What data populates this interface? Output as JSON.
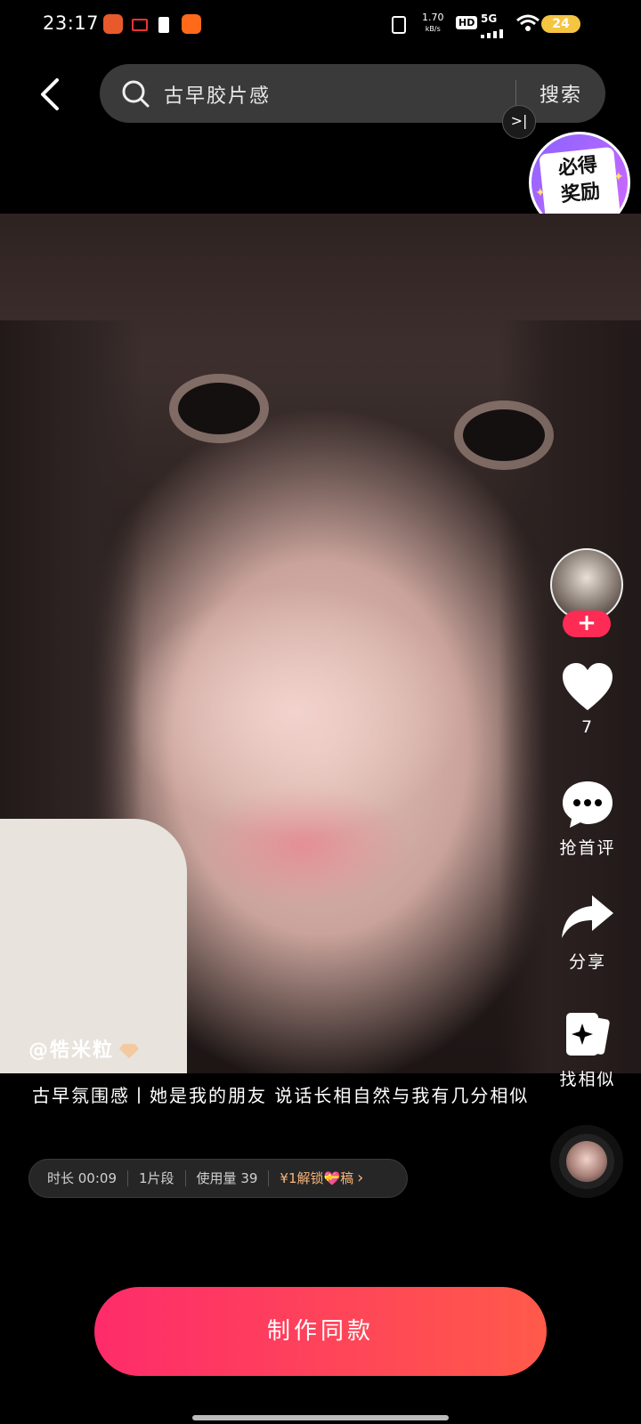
{
  "status_bar": {
    "time": "23:17",
    "net_speed": "1.70",
    "net_unit": "kB/s",
    "hd": "HD",
    "network": "5G",
    "battery": "24"
  },
  "search": {
    "query": "古早胶片感",
    "button_label": "搜索",
    "collapse_symbol": ">|"
  },
  "reward_badge": {
    "line1": "必得",
    "line2": "奖励"
  },
  "post": {
    "author": "@牿米粒",
    "description": "古早氛围感丨她是我的朋友 说话长相自然与我有几分相似",
    "info": {
      "duration": "时长 00:09",
      "segments": "1片段",
      "usage": "使用量 39",
      "unlock": "¥1解锁💝稿"
    }
  },
  "actions": {
    "follow_symbol": "+",
    "like_count": "7",
    "comment_label": "抢首评",
    "share_label": "分享",
    "similar_label": "找相似"
  },
  "cta": {
    "make_same_label": "制作同款"
  },
  "colors": {
    "accent": "#fe2c55",
    "cta_start": "#fe2c6a",
    "cta_end": "#ff5a4a",
    "unlock": "#f6b47c"
  }
}
